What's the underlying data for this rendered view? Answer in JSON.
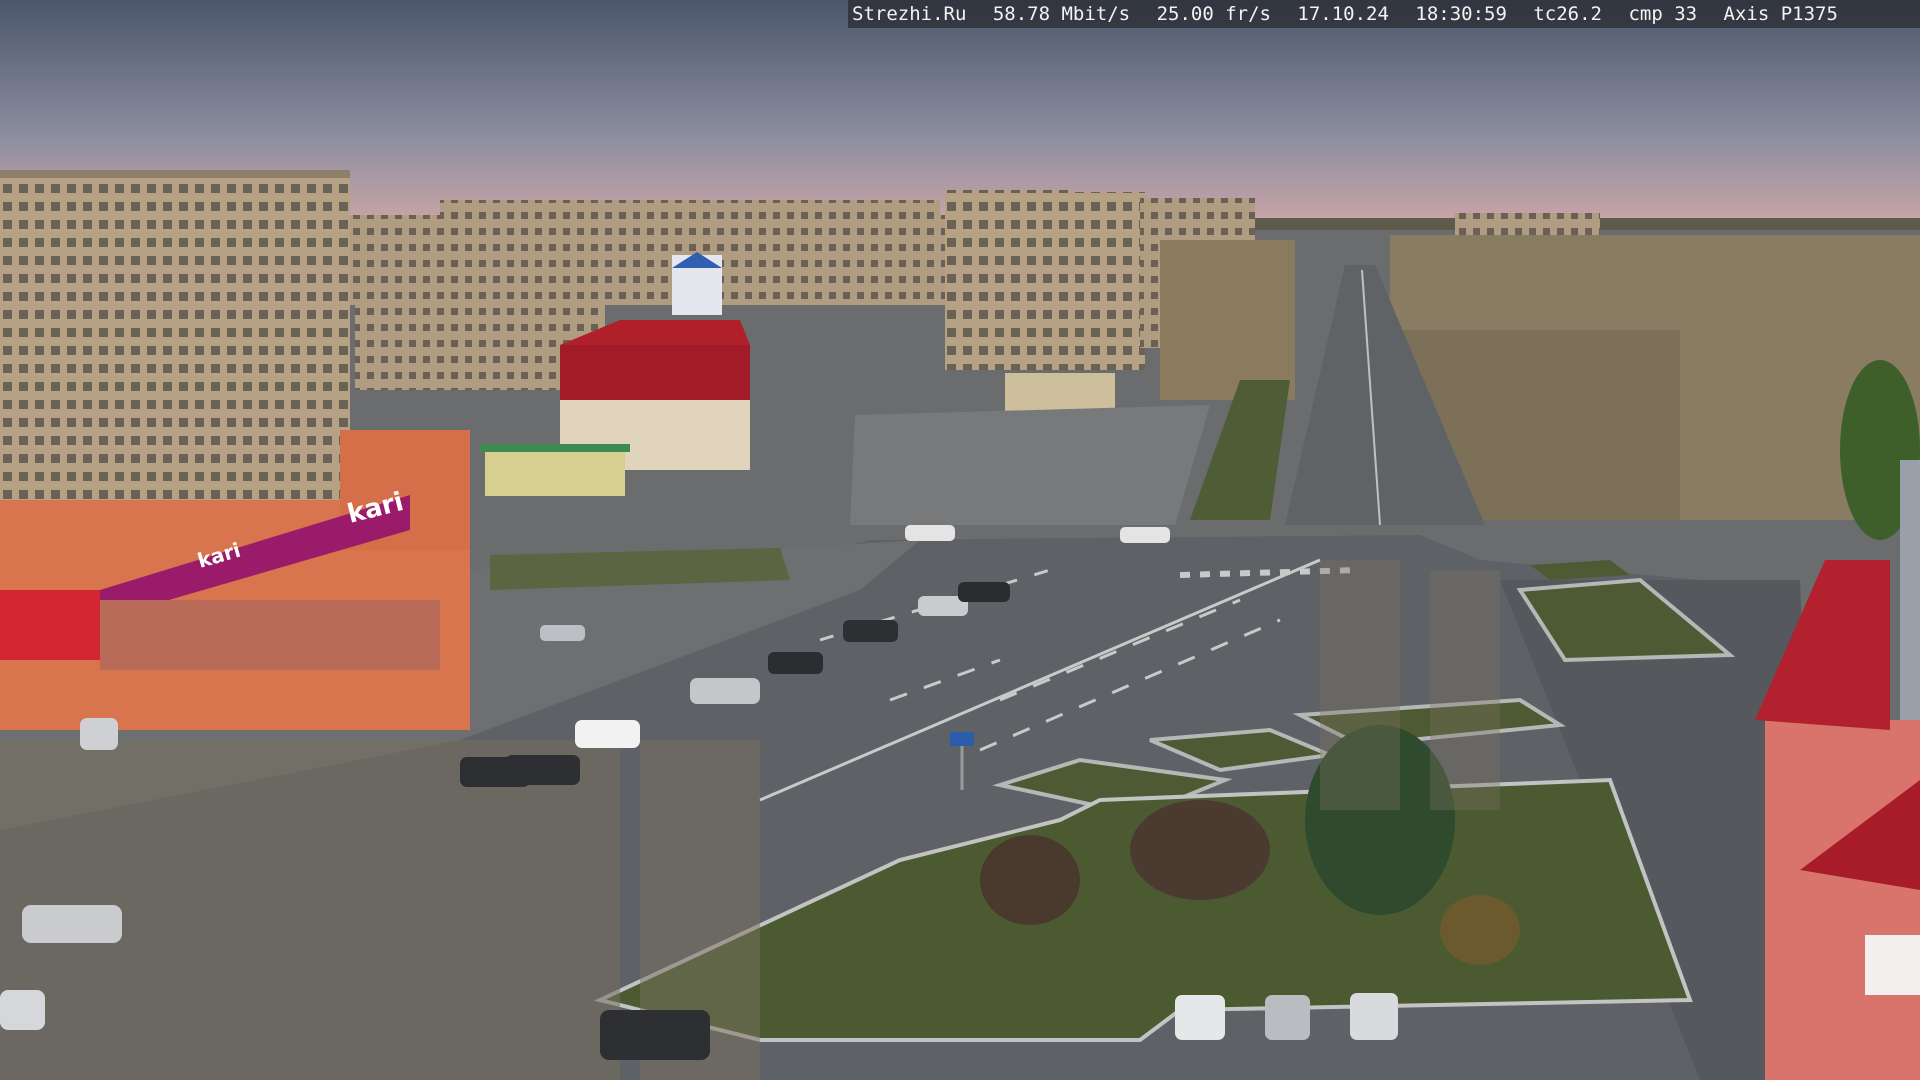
{
  "camera_overlay": {
    "site": "Strezhi.Ru",
    "bitrate": "58.78 Mbit/s",
    "framerate": "25.00 fr/s",
    "date": "17.10.24",
    "time": "18:30:59",
    "temperature": "tc26.2",
    "compression": "cmp 33",
    "camera_model": "Axis P1375"
  },
  "storefront_signs": {
    "main_banner": "kari",
    "secondary_banner": "kari"
  },
  "colors": {
    "sky_top": "#4e5a6f",
    "sky_horizon": "#cfa6a8",
    "road": "#5d6064",
    "grass": "#4d5b35",
    "building_beige": "#b5a184",
    "building_orange": "#d8744e",
    "kari_magenta": "#9b1b6b",
    "roof_red": "#b0202a"
  }
}
